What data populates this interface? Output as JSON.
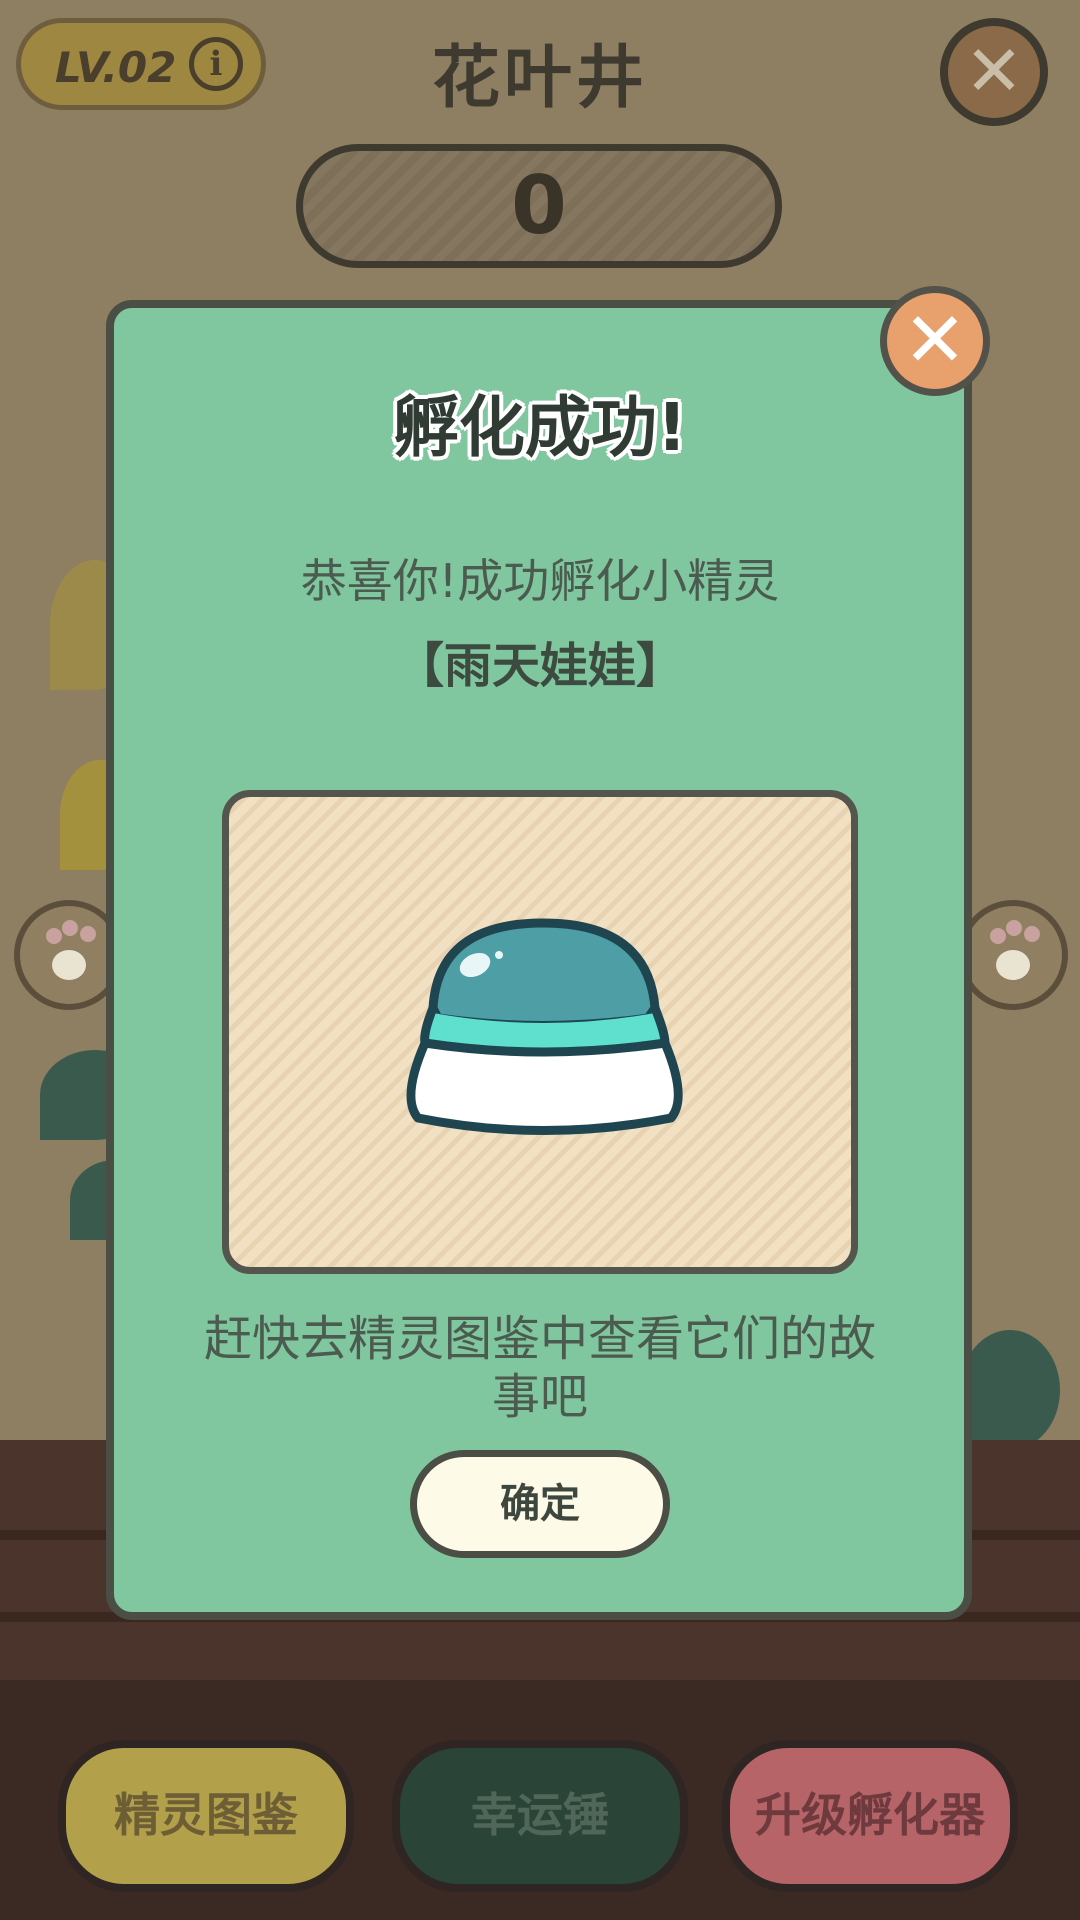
{
  "header": {
    "level": "LV.02",
    "title": "花叶井",
    "counter": "0"
  },
  "dialog": {
    "title": "孵化成功!",
    "message_line1": "恭喜你!成功孵化小精灵",
    "creature_name": "【雨天娃娃】",
    "message_line2": "赶快去精灵图鉴中查看它们的故事吧",
    "confirm_label": "确定"
  },
  "bottom_bar": {
    "dex_label": "精灵图鉴",
    "hammer_label": "幸运锤",
    "upgrade_label": "升级孵化器"
  },
  "icons": {
    "info": "info-icon",
    "close": "close-icon",
    "paw": "paw-icon",
    "egg": "egg-icon"
  },
  "colors": {
    "dialog_bg": "#80c69f",
    "close_button": "#e8a06c",
    "egg_top": "#4e9ea6",
    "egg_band": "#5fe0cf"
  }
}
